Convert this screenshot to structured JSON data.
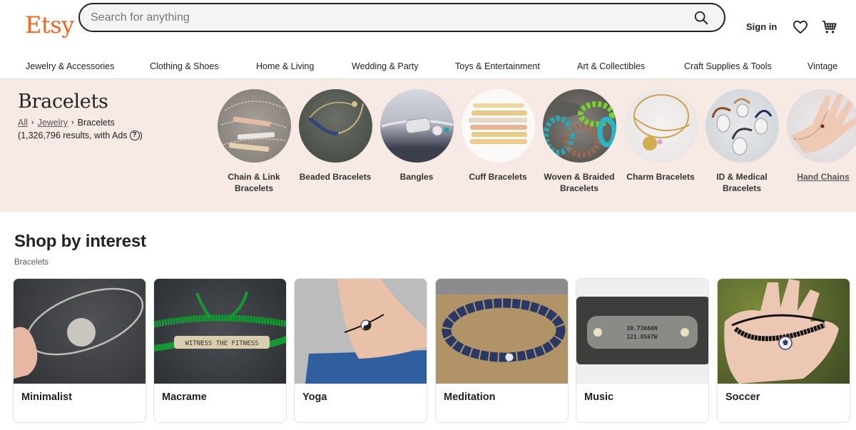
{
  "header": {
    "logo": "Etsy",
    "search": {
      "placeholder": "Search for anything",
      "value": ""
    },
    "sign_in": "Sign in",
    "icons": {
      "search": "search-icon",
      "favorites": "heart-icon",
      "cart": "cart-icon"
    }
  },
  "nav": {
    "items": [
      {
        "label": "Jewelry & Accessories"
      },
      {
        "label": "Clothing & Shoes"
      },
      {
        "label": "Home & Living"
      },
      {
        "label": "Wedding & Party"
      },
      {
        "label": "Toys & Entertainment"
      },
      {
        "label": "Art & Collectibles"
      },
      {
        "label": "Craft Supplies & Tools"
      },
      {
        "label": "Vintage"
      }
    ]
  },
  "banner": {
    "title": "Bracelets",
    "breadcrumb": [
      {
        "label": "All"
      },
      {
        "label": "Jewelry"
      },
      {
        "label": "Bracelets"
      }
    ],
    "breadcrumb_sep": "›",
    "results_text": "(1,326,796 results, with Ads",
    "results_close": ")",
    "help_glyph": "?",
    "categories": [
      {
        "label_line1": "Chain & Link",
        "label_line2": "Bracelets"
      },
      {
        "label_line1": "Beaded Bracelets",
        "label_line2": ""
      },
      {
        "label_line1": "Bangles",
        "label_line2": ""
      },
      {
        "label_line1": "Cuff Bracelets",
        "label_line2": ""
      },
      {
        "label_line1": "Woven & Braided",
        "label_line2": "Bracelets"
      },
      {
        "label_line1": "Charm Bracelets",
        "label_line2": ""
      },
      {
        "label_line1": "ID & Medical",
        "label_line2": "Bracelets"
      },
      {
        "label_line1": "Hand Chains",
        "label_line2": ""
      }
    ]
  },
  "interest": {
    "title": "Shop by interest",
    "subtitle": "Bracelets",
    "cards": [
      {
        "label": "Minimalist"
      },
      {
        "label": "Macrame",
        "engraving": "WITNESS THE FITNESS"
      },
      {
        "label": "Yoga"
      },
      {
        "label": "Meditation"
      },
      {
        "label": "Music",
        "engraving_line1": "39.73666N",
        "engraving_line2": "121.8567W"
      },
      {
        "label": "Soccer"
      }
    ]
  },
  "colors": {
    "brand": "#F1641E",
    "banner_bg": "#F7E9E4",
    "text": "#222222"
  }
}
